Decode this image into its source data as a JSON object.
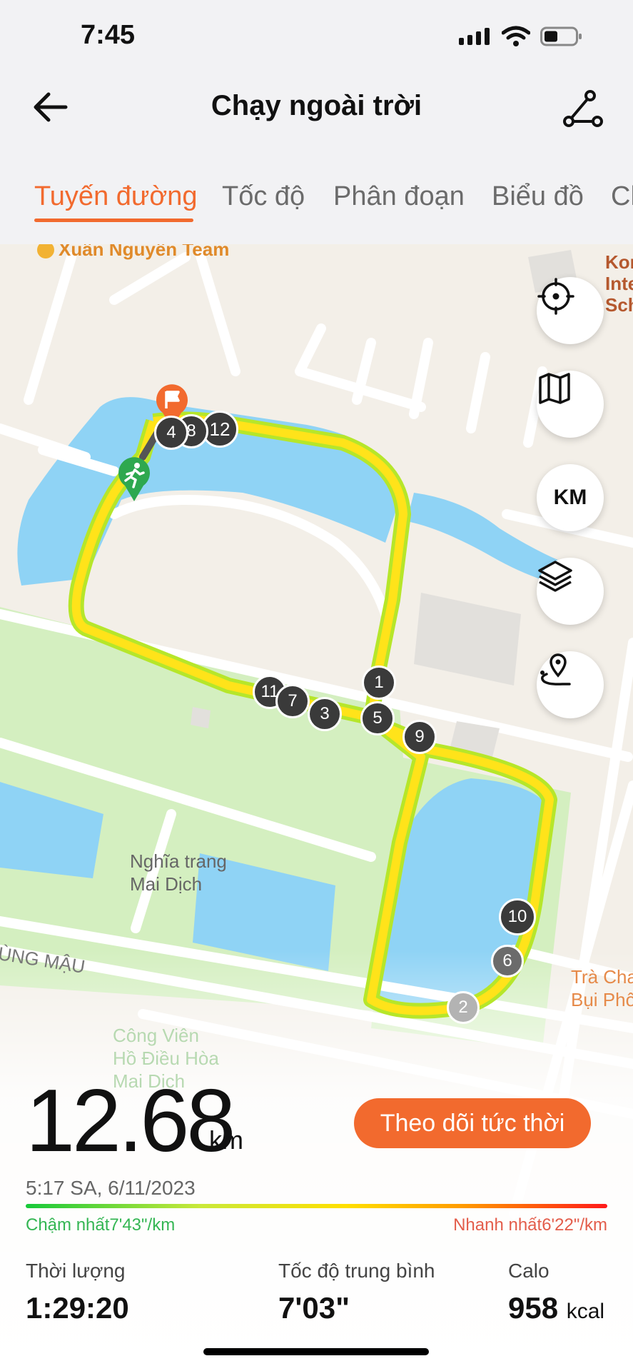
{
  "status": {
    "time": "7:45"
  },
  "nav": {
    "title": "Chạy ngoài trời"
  },
  "tabs": [
    {
      "label": "Tuyến đường",
      "active": true
    },
    {
      "label": "Tốc độ",
      "active": false
    },
    {
      "label": "Phân đoạn",
      "active": false
    },
    {
      "label": "Biểu đồ",
      "active": false
    },
    {
      "label": "Ch",
      "active": false
    }
  ],
  "map": {
    "labels": {
      "team": "Xuân Nguyễn Team",
      "korean_school": "Kor\nInte\nSch",
      "cemetery": "Nghĩa trang\nMai Dịch",
      "road": "ÙNG MẬU",
      "cafe": "Trà Cha\nBụi Phố",
      "park": "Công Viên\nHồ Điều Hòa\nMai Dịch"
    },
    "km_markers": [
      "1",
      "2",
      "3",
      "4",
      "5",
      "6",
      "7",
      "8",
      "9",
      "10",
      "11",
      "12"
    ],
    "buttons": {
      "units": "KM"
    }
  },
  "summary": {
    "distance": "12.68",
    "distance_unit": "km",
    "live_button": "Theo dõi tức thời",
    "datetime": "5:17 SA, 6/11/2023",
    "slowest": "Chậm nhất7'43\"/km",
    "fastest": "Nhanh nhất6'22\"/km",
    "duration_label": "Thời lượng",
    "duration": "1:29:20",
    "avg_pace_label": "Tốc độ trung bình",
    "avg_pace": "7'03\"",
    "calories_label": "Calo",
    "calories": "958",
    "calories_unit": "kcal"
  },
  "colors": {
    "accent": "#f26a2e",
    "route": "#ffe31a",
    "water": "#8fd3f5",
    "grass": "#d4efc0"
  }
}
